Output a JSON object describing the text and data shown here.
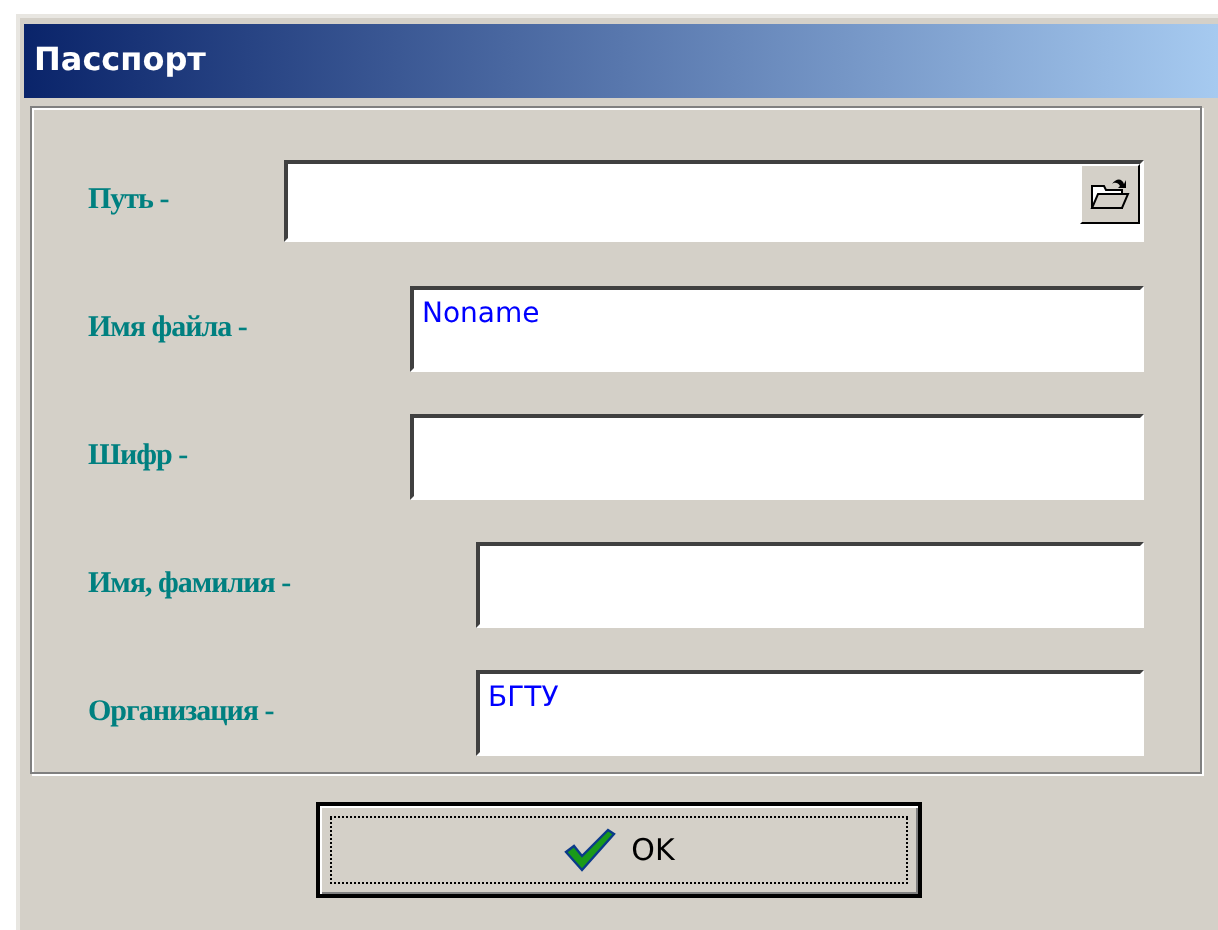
{
  "window": {
    "title": "Пасспорт"
  },
  "fields": [
    {
      "label": "Путь -",
      "kind": "browse"
    },
    {
      "label": "Имя файла -",
      "value": "Noname",
      "kind": "text"
    },
    {
      "label": "Шифр -",
      "kind": "text"
    },
    {
      "label": "Имя, фамилия -",
      "kind": "text"
    },
    {
      "label": "Организация -",
      "value": "БГТУ",
      "kind": "text"
    }
  ],
  "buttons": [
    {
      "label": "OK",
      "focused": true
    }
  ]
}
